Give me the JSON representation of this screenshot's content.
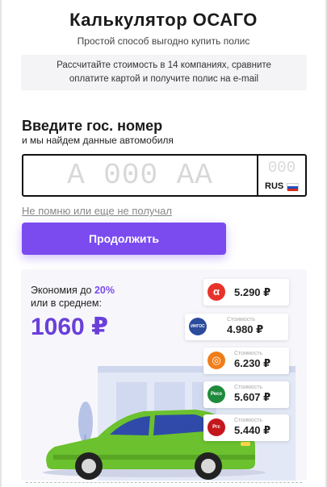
{
  "header": {
    "title": "Калькулятор ОСАГО",
    "subtitle": "Простой способ выгодно купить полис"
  },
  "info": {
    "line1": "Рассчитайте стоимость в 14 компаниях, сравните",
    "line2": "оплатите картой и получите полис на e-mail"
  },
  "plate_form": {
    "heading": "Введите гос. номер",
    "subheading": "и мы найдем данные автомобиля",
    "number_placeholder": "А 000 АА",
    "region_placeholder": "000",
    "country": "RUS",
    "forgot_link": "Не помню или еще не получал",
    "continue_label": "Продолжить"
  },
  "promo": {
    "savings_prefix": "Экономия до ",
    "savings_percent": "20%",
    "savings_suffix": "или в среднем:",
    "savings_amount": "1060 ₽",
    "offers": [
      {
        "logo_icon": "alfa-logo-icon",
        "logo_text": "α",
        "color": "#e8332a",
        "caption": "",
        "price": "5.290 ₽"
      },
      {
        "logo_icon": "ingos-logo-icon",
        "logo_text": "ИНГОС",
        "color": "#2b4b9b",
        "caption": "Стоимость",
        "price": "4.980 ₽"
      },
      {
        "logo_icon": "ring-logo-icon",
        "logo_text": "◎",
        "color": "#f07d1a",
        "caption": "Стоимость",
        "price": "6.230 ₽"
      },
      {
        "logo_icon": "reso-logo-icon",
        "logo_text": "Ресо",
        "color": "#1f8a3c",
        "caption": "Стоимость",
        "price": "5.607 ₽"
      },
      {
        "logo_icon": "rgs-logo-icon",
        "logo_text": "Ргс",
        "color": "#c4161c",
        "caption": "Стоимость",
        "price": "5.440 ₽"
      }
    ]
  },
  "colors": {
    "accent": "#7b4bf0",
    "savings_amount": "#6a3fd9",
    "car_body": "#6bc12e"
  }
}
